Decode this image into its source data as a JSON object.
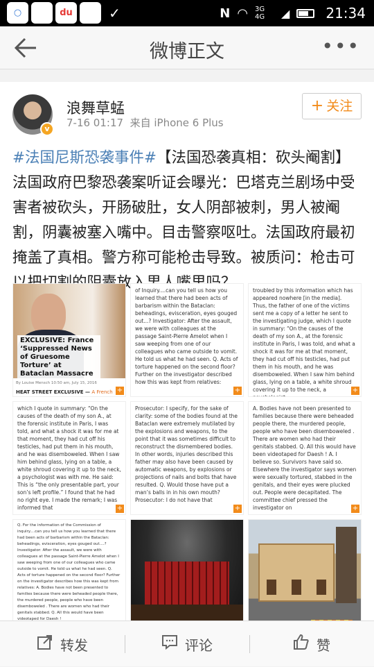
{
  "status_bar": {
    "app_icons": [
      "○",
      "",
      "du",
      "",
      "✓"
    ],
    "signal_text": "3G 4G",
    "time": "21:34"
  },
  "nav": {
    "title": "微博正文",
    "more": "•••"
  },
  "post": {
    "username": "浪舞草蜢",
    "timestamp": "7-16 01:17",
    "source": "来自 iPhone 6 Plus",
    "follow_label": "关注",
    "hashtag": "#法国尼斯恐袭事件#",
    "text": "【法国恐袭真相：砍头阉割】法国政府巴黎恐袭案听证会曝光：巴塔克兰剧场中受害者被砍头，开肠破肚，女人阴部被刺，男人被阉割，阴囊被塞入嘴中。目击警察呕吐。法国政府最初掩盖了真相。警方称可能枪击导致。被质问：枪击可以把切割的阴囊放入男人嘴里吗？"
  },
  "images": {
    "img1_headline": "EXCLUSIVE: France ‘Suppressed News of Gruesome Torture’ at Bataclan Massacre",
    "img1_byline": "By Louise Mensch  10:50 am, July 15, 2016",
    "img1_section": "HEAT STREET EXCLUSIVE",
    "img1_link": "A French",
    "img2_text": "of Inquiry....can you tell us how you learned that there had been acts of barbarism within the Bataclan: beheadings, evisceration, eyes gouged out...? Investigator: After the assault, we were with colleagues at the passage Saint-Pierre Amelot when I saw weeping from one of our colleagues who came outside to vomit. He told us what he had seen. Q. Acts of torture happened on the second floor? Further on the investigator described how this was kept from relatives:",
    "img3_text": "troubled by this information which has appeared nowhere [in the media]. Thus, the father of one of the victims sent me a copy of a letter he sent to the investigating judge, which I quote in summary: “On the causes of the death of my son A., at the forensic institute in Paris, I was told, and what a shock it was for me at that moment, they had cut off his testicles, had put them in his mouth, and he was disemboweled. When I saw him behind glass, lying on a table, a white shroud covering it up to the neck, a psychologist",
    "img4_text": "which I quote in summary: “On the causes of the death of my son A., at the forensic institute in Paris, I was told, and what a shock it was for me at that moment, they had cut off his testicles, had put them in his mouth, and he was disemboweled. When I saw him behind glass, lying on a table, a white shroud covering it up to the neck, a psychologist was with me. He said: This is “the only presentable part, your son’s left profile.” I found that he had no right eye. I made the remark; I was informed that",
    "img5_text": "Prosecutor: I specify, for the sake of clarity: some of the bodies found at the Bataclan were extremely mutilated by the explosions and weapons, to the point that it was sometimes difficult to reconstruct the dismembered bodies. In other words, injuries described this father may also have been caused by automatic weapons, by explosions or projections of nails and bolts that have resulted. Q. Would those have put a man’s balls in in his own mouth? Prosecutor: I do not have that",
    "img6_text": "A. Bodies have not been presented to families because there were beheaded people there, the murdered people, people who have been disemboweled . There are women who had their genitals stabbed. Q. All this would have been videotaped for Daesh ! A. I believe so. Survivors have said so. Elsewhere the investigator says women were sexually tortured, stabbed in the genitals, and their eyes were plucked out. People were decapitated. The committee chief pressed the investigator on",
    "img7_text": "Q. For the information of the Commission of inquiry....can you tell us how you learned that there had been acts of barbarism within the Bataclan: beheadings, evisceration, eyes gouged out....? Investigator: After the assault, we were with colleagues at the passage Saint-Pierre Amelot when I saw weeping from one of our colleagues who came outside to vomit. He told us what he had seen. Q. Acts of torture happened on the second floor? Further on the investigator describes how this was kept from relatives: A. Bodies have not been presented to families because there were beheaded people there, the murdered people, people who have been disemboweled . There are women who had their genitals stabbed. Q. All this would have been videotaped for Daesh !",
    "plus_badge": "+"
  },
  "actions": {
    "repost": "转发",
    "comment": "评论",
    "like": "赞"
  },
  "colors": {
    "accent_orange": "#f28b1a",
    "hashtag_blue": "#4a7fb5"
  }
}
